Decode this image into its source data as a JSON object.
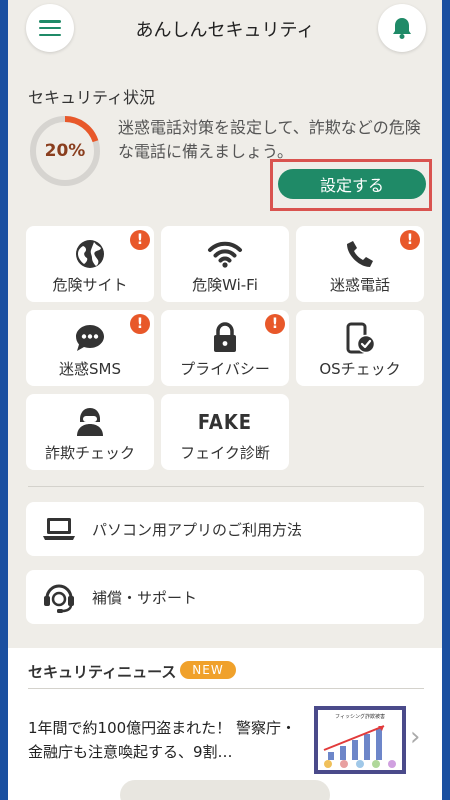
{
  "header": {
    "title": "あんしんセキュリティ"
  },
  "status": {
    "title": "セキュリティ状況",
    "percent": 0.2,
    "percent_label": "20%",
    "description": "迷惑電話対策を設定して、詐欺などの危険な電話に備えましょう。",
    "setup_button": "設定する"
  },
  "tiles": [
    {
      "label": "危険サイト",
      "icon": "globe-icon",
      "alert": true
    },
    {
      "label": "危険Wi-Fi",
      "icon": "wifi-icon",
      "alert": false
    },
    {
      "label": "迷惑電話",
      "icon": "phone-icon",
      "alert": true
    },
    {
      "label": "迷惑SMS",
      "icon": "chat-bubble-icon",
      "alert": true
    },
    {
      "label": "プライバシー",
      "icon": "lock-icon",
      "alert": true
    },
    {
      "label": "OSチェック",
      "icon": "phone-check-icon",
      "alert": false
    },
    {
      "label": "詐欺チェック",
      "icon": "hooded-person-icon",
      "alert": false
    },
    {
      "label": "フェイク診断",
      "icon": "fake-text-icon",
      "icon_text": "FAKE",
      "alert": false
    }
  ],
  "alert_mark": "!",
  "rows": [
    {
      "label": "パソコン用アプリのご利用方法",
      "icon": "laptop-icon"
    },
    {
      "label": "補償・サポート",
      "icon": "headset-icon"
    }
  ],
  "news": {
    "title": "セキュリティニュース",
    "badge": "NEW",
    "headline": "1年間で約100億円盗まれた！ 警察庁・金融庁も注意喚起する、9割…",
    "thumb_caption": "フィッシング詐欺被害"
  },
  "colors": {
    "accent": "#1f8a67",
    "alert": "#e8582a",
    "gauge": "#e8582a",
    "highlight_frame": "#d9534f",
    "new_badge": "#f0a12b",
    "border": "#1a4fa0"
  }
}
